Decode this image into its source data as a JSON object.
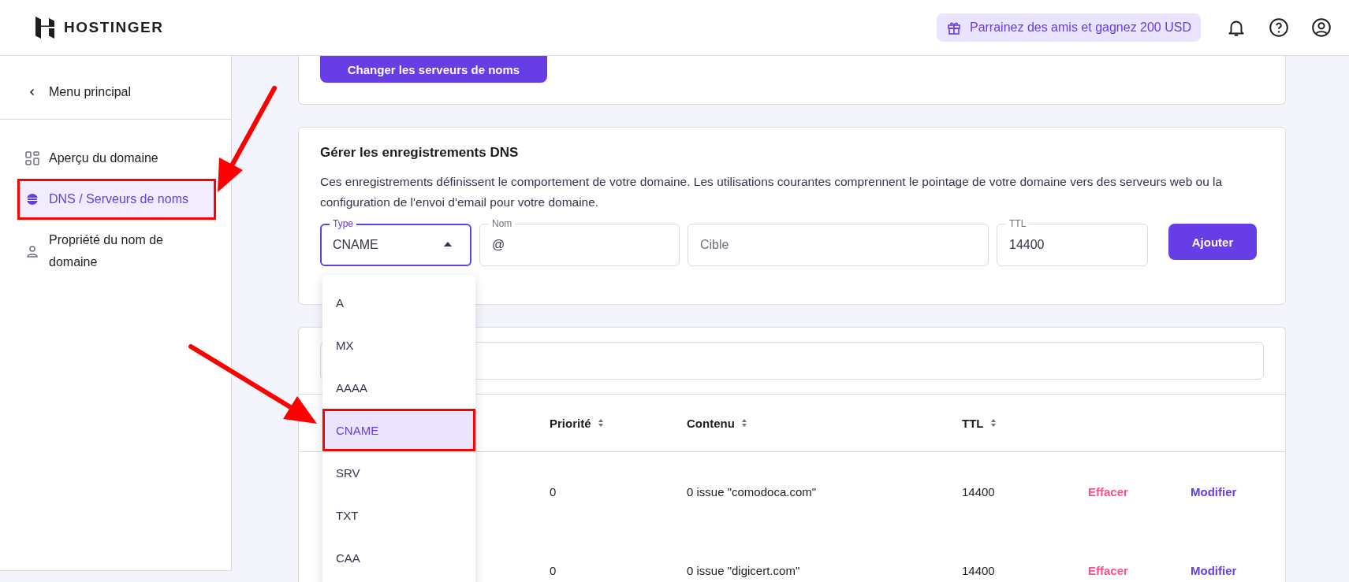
{
  "header": {
    "brand": "HOSTINGER",
    "referral": "Parrainez des amis et gagnez 200 USD"
  },
  "sidebar": {
    "back": "Menu principal",
    "items": [
      {
        "label": "Aperçu du domaine",
        "kind": "grid",
        "selected": false
      },
      {
        "label": "DNS / Serveurs de noms",
        "kind": "dns",
        "selected": true
      },
      {
        "label": "Propriété du nom de domaine",
        "kind": "person",
        "selected": false
      }
    ]
  },
  "nameservers_card": {
    "button": "Changer les serveurs de noms"
  },
  "dns_card": {
    "title": "Gérer les enregistrements DNS",
    "description": "Ces enregistrements définissent le comportement de votre domaine. Les utilisations courantes comprennent le pointage de votre domaine vers des serveurs web ou la configuration de l'envoi d'email pour votre domaine.",
    "fields": [
      {
        "kind": "select",
        "label": "Type",
        "value": "CNAME",
        "focused": true
      },
      {
        "kind": "text",
        "label": "Nom",
        "value": "@",
        "focused": false
      },
      {
        "kind": "text",
        "placeholder": "Cible",
        "focused": false
      },
      {
        "kind": "text",
        "label": "TTL",
        "value": "14400",
        "focused": false
      }
    ],
    "add_button": "Ajouter",
    "type_options": [
      {
        "label": "A",
        "selected": false
      },
      {
        "label": "MX",
        "selected": false
      },
      {
        "label": "AAAA",
        "selected": false
      },
      {
        "label": "CNAME",
        "selected": true
      },
      {
        "label": "SRV",
        "selected": false
      },
      {
        "label": "TXT",
        "selected": false
      },
      {
        "label": "CAA",
        "selected": false
      }
    ]
  },
  "records": {
    "columns": [
      "Priorité",
      "Contenu",
      "TTL"
    ],
    "rows": [
      {
        "priority": "0",
        "content": "0 issue \"comodoca.com\"",
        "ttl": "14400",
        "delete": "Effacer",
        "edit": "Modifier"
      },
      {
        "priority": "0",
        "content": "0 issue \"digicert.com\"",
        "ttl": "14400",
        "delete": "Effacer",
        "edit": "Modifier"
      }
    ]
  }
}
